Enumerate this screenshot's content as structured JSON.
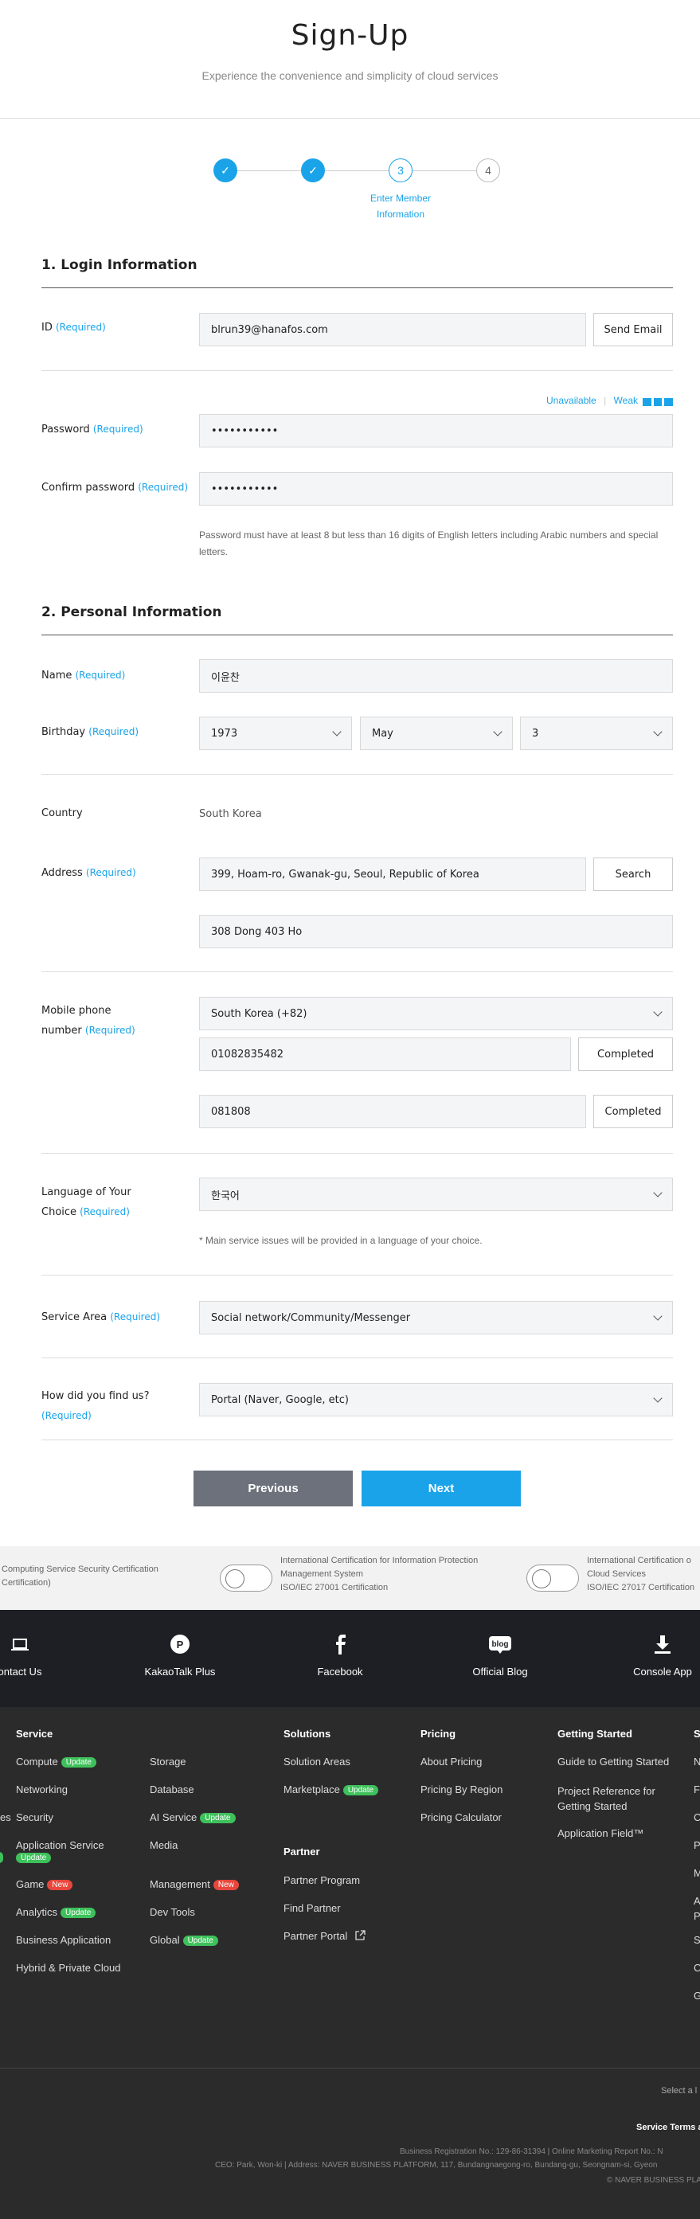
{
  "header": {
    "title": "Sign-Up",
    "subtitle": "Experience the convenience and simplicity of cloud services"
  },
  "steps": {
    "current_number": "3",
    "current_label_line1": "Enter Member",
    "current_label_line2": "Information",
    "next_number": "4",
    "check": "✓"
  },
  "login": {
    "title": "1. Login Information",
    "id_label": "ID",
    "required": "(Required)",
    "id_value": "blrun39@hanafos.com",
    "send_email": "Send Email",
    "strength_unavailable": "Unavailable",
    "strength_sep": "|",
    "strength_weak": "Weak",
    "password_label": "Password",
    "password_value": "•••••••••••",
    "confirm_label": "Confirm password",
    "confirm_value": "•••••••••••",
    "password_hint_1": "Password must have at least 8 but less than 16 digits of English letters including Arabic numbers and special",
    "password_hint_2": "letters."
  },
  "personal": {
    "title": "2. Personal Information",
    "name_label": "Name",
    "name_value": "이윤찬",
    "birthday_label": "Birthday",
    "birth_year": "1973",
    "birth_month": "May",
    "birth_day": "3",
    "country_label": "Country",
    "country_value": "South Korea",
    "address_label": "Address",
    "address_value": "399, Hoam-ro, Gwanak-gu, Seoul, Republic of Korea",
    "search": "Search",
    "address_detail": "308 Dong 403 Ho",
    "mobile_label_1": "Mobile phone",
    "mobile_label_2": "number",
    "mobile_country": "South Korea (+82)",
    "mobile_number": "01082835482",
    "completed": "Completed",
    "verify_code": "081808",
    "language_label_1": "Language of Your",
    "language_label_2": "Choice",
    "language_value": "한국어",
    "language_hint": "* Main service issues will be provided in a language of your choice.",
    "service_area_label": "Service Area",
    "service_area_value": "Social network/Community/Messenger",
    "find_label": "How did you find us?",
    "find_value": "Portal (Naver, Google, etc)"
  },
  "nav": {
    "previous": "Previous",
    "next": "Next"
  },
  "certs": [
    {
      "line1": "Computing Service Security Certification",
      "line2": "Certification)",
      "line3": ""
    },
    {
      "line1": "International Certification for Information Protection",
      "line2": "Management System",
      "line3": "ISO/IEC 27001 Certification"
    },
    {
      "line1": "International Certification o",
      "line2": "Cloud Services",
      "line3": "ISO/IEC 27017 Certification"
    }
  ],
  "contact_bar": [
    {
      "label": "ontact Us",
      "icon": "laptop-icon"
    },
    {
      "label": "KakaoTalk Plus",
      "icon": "kakaotalk-icon"
    },
    {
      "label": "Facebook",
      "icon": "facebook-icon"
    },
    {
      "label": "Official Blog",
      "icon": "blog-icon",
      "icon_text": "blog"
    },
    {
      "label": "Console App",
      "icon": "download-icon"
    }
  ],
  "footer": {
    "service": "Service",
    "solutions": "Solutions",
    "pricing": "Pricing",
    "getting_started": "Getting Started",
    "s_cut": "S",
    "compute": "Compute",
    "networking": "Networking",
    "es": "es",
    "security": "Security",
    "app_service": "Application Service",
    "game": "Game",
    "analytics": "Analytics",
    "business_app": "Business Application",
    "hybrid": "Hybrid & Private Cloud",
    "storage": "Storage",
    "database": "Database",
    "ai_service": "AI Service",
    "media": "Media",
    "management": "Management",
    "dev_tools": "Dev Tools",
    "global": "Global",
    "solution_areas": "Solution Areas",
    "marketplace": "Marketplace",
    "partner": "Partner",
    "partner_program": "Partner Program",
    "find_partner": "Find Partner",
    "partner_portal": "Partner Portal",
    "about_pricing": "About Pricing",
    "pricing_region": "Pricing By Region",
    "pricing_calc": "Pricing Calculator",
    "guide": "Guide to Getting Started",
    "project_ref_1": "Project Reference for",
    "project_ref_2": "Getting Started",
    "app_field": "Application Field™",
    "update": "Update",
    "new": "New",
    "cut_n": "N",
    "cut_f": "F",
    "cut_c": "C",
    "cut_p": "P",
    "cut_m": "M",
    "cut_a": "A",
    "cut_p2": "P",
    "cut_s": "S",
    "cut_c2": "C",
    "cut_g": "G",
    "select_lang": "Select a l",
    "service_terms": "Service Terms a",
    "biz_reg": "Business Registration No.: 129-86-31394  |  Online Marketing Report No.: N",
    "ceo": "CEO: Park, Won-ki  |  Address: NAVER BUSINESS PLATFORM, 117, Bundangnaegong-ro, Bundang-gu, Seongnam-si, Gyeon",
    "copyright": "© NAVER BUSINESS PLA"
  }
}
